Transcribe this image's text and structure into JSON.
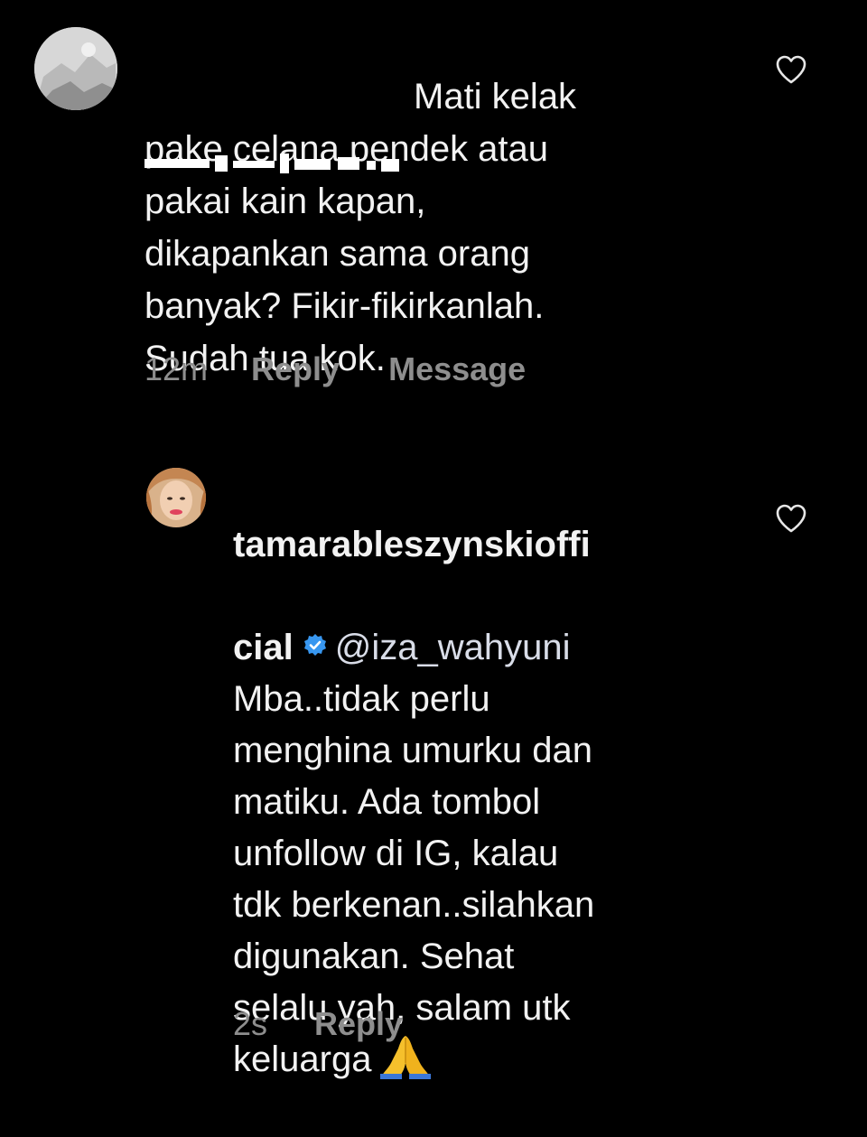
{
  "comments": [
    {
      "username_redacted": true,
      "text_first": "Mati kelak",
      "text_rest": "pake celana pendek atau\npakai kain kapan,\ndikapankan sama orang\nbanyak? Fikir-fikirkanlah.\nSudah tua kok.",
      "time": "12m",
      "reply_label": "Reply",
      "message_label": "Message",
      "icons": {
        "like": "heart-outline-icon",
        "avatar": "avatar-image"
      }
    },
    {
      "username_line1": "tamarableszynskioffi",
      "username_line2": "cial",
      "mention": "@iza_wahyuni",
      "text_rest": "Mba..tidak perlu\nmenghina umurku dan\nmatiku. Ada tombol\nunfollow di IG, kalau\ntdk berkenan..silahkan\ndigunakan. Sehat\nselalu yah, salam utk\nkeluarga",
      "time": "2s",
      "reply_label": "Reply",
      "icons": {
        "like": "heart-outline-icon",
        "verified": "verified-badge-icon",
        "emoji": "folded-hands-emoji"
      }
    }
  ],
  "colors": {
    "background": "#000000",
    "text": "#f2f2f2",
    "meta": "#8e8e8e",
    "verified": "#3897f0"
  }
}
